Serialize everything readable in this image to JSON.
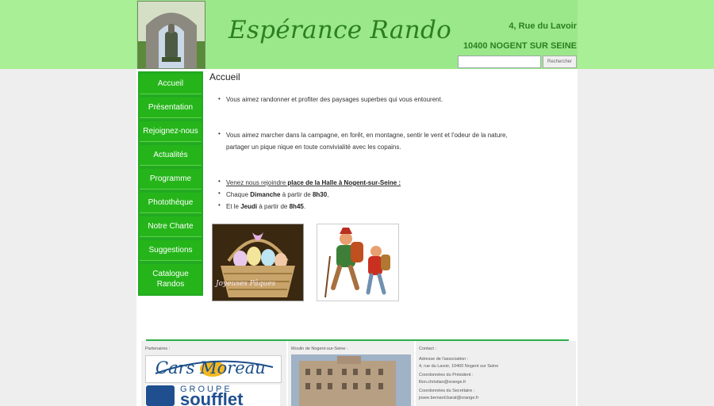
{
  "header": {
    "title": "Espérance Rando",
    "address_line1": "4, Rue du Lavoir",
    "address_line2": "10400 NOGENT SUR SEINE",
    "search_button": "Rechercher",
    "search_value": ""
  },
  "sidebar": {
    "items": [
      {
        "label": "Accueil"
      },
      {
        "label": "Présentation"
      },
      {
        "label": "Rejoignez-nous"
      },
      {
        "label": "Actualités"
      },
      {
        "label": "Programme"
      },
      {
        "label": "Photothèque"
      },
      {
        "label": "Notre Charte"
      },
      {
        "label": "Suggestions"
      },
      {
        "label": "Catalogue Randos"
      }
    ]
  },
  "content": {
    "heading": "Accueil",
    "p1": "Vous aimez randonner et profiter des paysages superbes qui vous entourent.",
    "p2_line1": "Vous aimez marcher dans la campagne, en forêt, en montagne, sentir le vent et l'odeur de la nature,",
    "p2_line2": "partager un pique nique en toute convivialité avec les copains.",
    "join_prefix": "Venez nous rejoindre ",
    "join_bold": "place de la Halle à Nogent-sur-Seine :",
    "sun_prefix": "Chaque ",
    "sun_day": "Dimanche",
    "sun_mid": " à partir de ",
    "sun_time": "8h30",
    "sun_end": ",",
    "thu_prefix": "Et le ",
    "thu_day": "Jeudi",
    "thu_mid": " à partir de ",
    "thu_time": "8h45",
    "thu_end": ".",
    "easter_caption": "Joyeuses Pâques"
  },
  "footer": {
    "partners_label": "Partenaires :",
    "partner1": "Cars Moreau",
    "partner2_top": "GROUPE",
    "partner2_bottom": "soufflet",
    "mill_label": "Moulin de Nogent-sur-Seine :",
    "contact_label": "Contact :",
    "contact_addr_label": "Adresse de l'association :",
    "contact_addr": "4, rue du Lavoir, 10400 Nogent sur Seine",
    "president_label": "Coordonnées du Président :",
    "president_email": "llion.christian@orange.fr",
    "secretary_label": "Coordonnées du Secrétaire :",
    "secretary_email": "josee.bernard.barat@orange.fr"
  },
  "colors": {
    "header_green": "#9be88a",
    "nav_green": "#25b51a",
    "title_green": "#2a7f22",
    "divider": "#2eae4e"
  }
}
